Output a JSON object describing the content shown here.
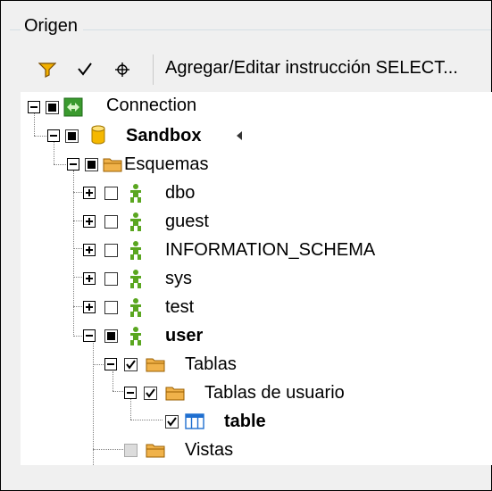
{
  "panel": {
    "title": "Origen"
  },
  "toolbar": {
    "filter_icon": "filter-icon",
    "check_icon": "checkmark-icon",
    "crosshair_icon": "crosshair-icon",
    "select_label": "Agregar/Editar instrucción SELECT..."
  },
  "tree": {
    "connection": "Connection",
    "sandbox": "Sandbox",
    "esquemas": "Esquemas",
    "dbo": "dbo",
    "guest": "guest",
    "information_schema": "INFORMATION_SCHEMA",
    "sys": "sys",
    "test": "test",
    "user": "user",
    "tablas": "Tablas",
    "tablas_usuario": "Tablas de usuario",
    "table": "table",
    "vistas": "Vistas"
  },
  "colors": {
    "connection_green": "#3a9a2e",
    "db_gold": "#f5b800",
    "folder_orange": "#e8a33a",
    "schema_green": "#5aa620",
    "table_blue": "#1f6fd0"
  }
}
